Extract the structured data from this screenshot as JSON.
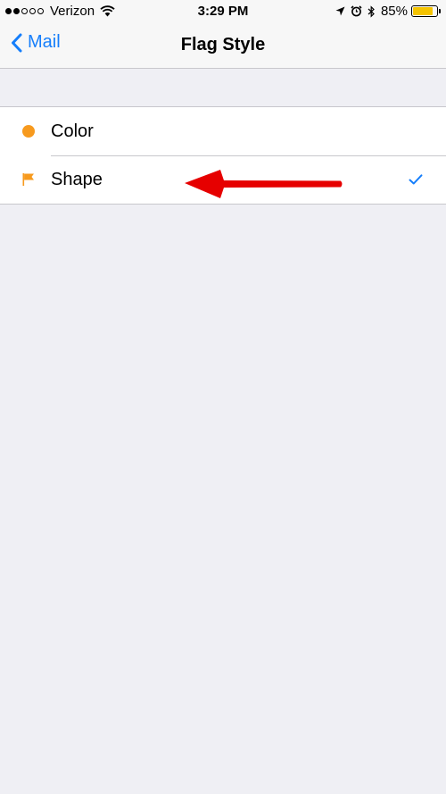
{
  "status_bar": {
    "carrier": "Verizon",
    "time": "3:29 PM",
    "battery": "85%",
    "battery_level": 85,
    "signal_bars": 2,
    "signal_total": 5
  },
  "nav": {
    "back_label": "Mail",
    "title": "Flag Style"
  },
  "options": [
    {
      "label": "Color",
      "icon": "orange-dot-icon",
      "selected": false
    },
    {
      "label": "Shape",
      "icon": "flag-icon",
      "selected": true
    }
  ],
  "colors": {
    "accent": "#157efb",
    "flag": "#f79a1e",
    "annotation_arrow": "#e60000",
    "background": "#efeff4"
  }
}
